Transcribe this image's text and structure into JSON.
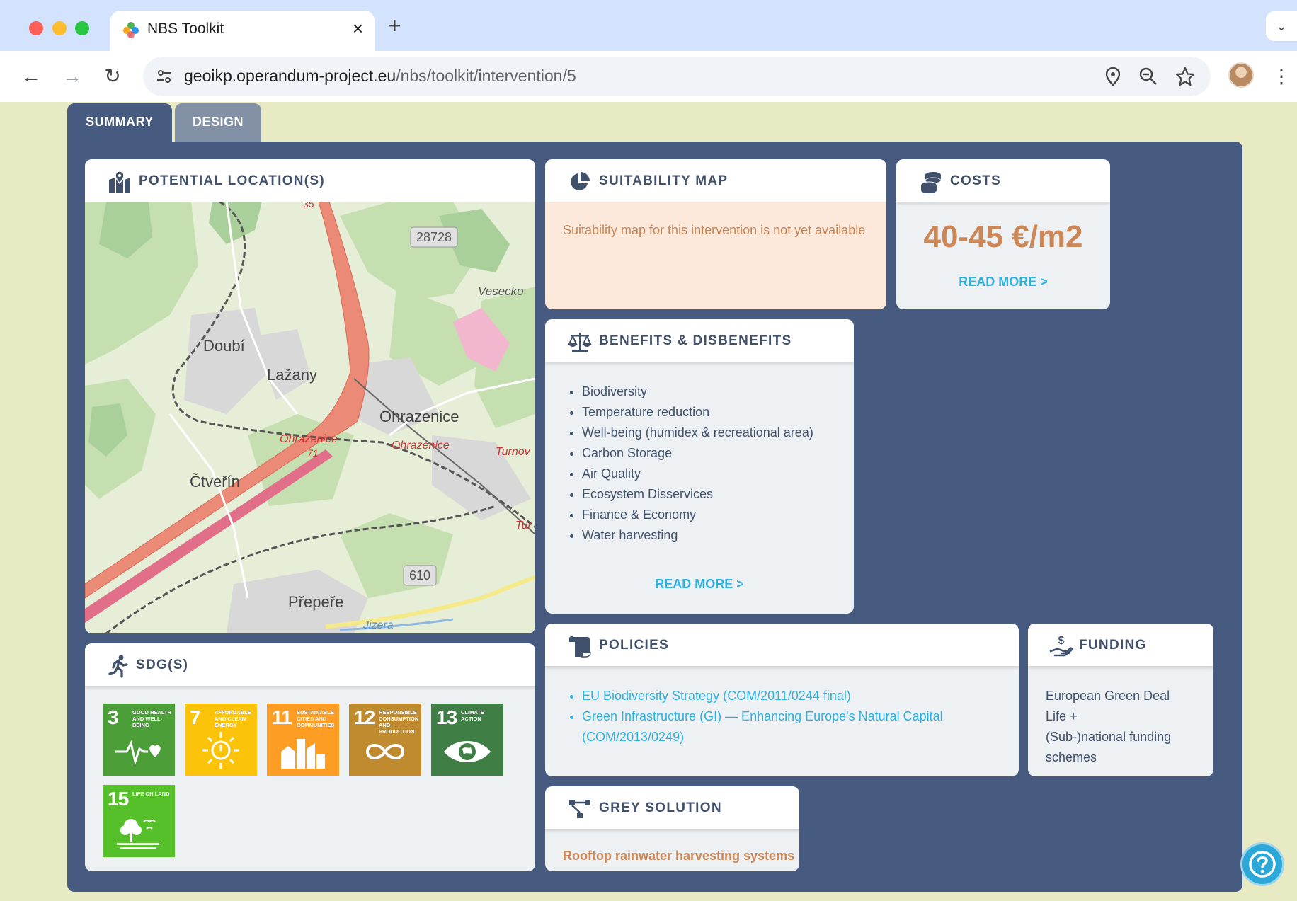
{
  "browser": {
    "tab_title": "NBS Toolkit",
    "url_host": "geoikp.operandum-project.eu",
    "url_path": "/nbs/toolkit/intervention/5"
  },
  "page_tabs": {
    "summary": "SUMMARY",
    "design": "DESIGN"
  },
  "location": {
    "title": "POTENTIAL LOCATION(S)",
    "map_labels": {
      "doubi": "Doubí",
      "lazany": "Lažany",
      "ohrazenice": "Ohrazenice",
      "cverin": "Čtveřín",
      "prepere": "Přepeře",
      "vesecko": "Vesecko",
      "ohrazenice71": "Ohrazenice",
      "km71": "71",
      "ohrazenice_station": "Ohrazenice",
      "turnov": "Turnov",
      "tur": "Tur",
      "jizera": "Jizera",
      "road28728": "28728",
      "road610": "610",
      "road35": "35"
    }
  },
  "suitability": {
    "title": "SUITABILITY MAP",
    "message": "Suitability map for this intervention is not yet available"
  },
  "costs": {
    "title": "COSTS",
    "value": "40-45 €/m2",
    "read_more": "READ MORE >"
  },
  "benefits": {
    "title": "BENEFITS & DISBENEFITS",
    "items": [
      "Biodiversity",
      "Temperature reduction",
      "Well-being (humidex & recreational area)",
      "Carbon Storage",
      "Air Quality",
      "Ecosystem Disservices",
      "Finance & Economy",
      "Water harvesting"
    ],
    "read_more": "READ MORE >"
  },
  "sdgs": {
    "title": "SDG(S)",
    "items": [
      {
        "num": "3",
        "label": "Good health and well-being",
        "color": "#4c9f38"
      },
      {
        "num": "7",
        "label": "Affordable and clean energy",
        "color": "#fcc30b"
      },
      {
        "num": "11",
        "label": "Sustainable cities and communities",
        "color": "#fd9d24"
      },
      {
        "num": "12",
        "label": "Responsible consumption and production",
        "color": "#bf8b2e"
      },
      {
        "num": "13",
        "label": "Climate action",
        "color": "#3f7e44"
      },
      {
        "num": "15",
        "label": "Life on land",
        "color": "#56c02b"
      }
    ]
  },
  "policies": {
    "title": "POLICIES",
    "items": [
      "EU Biodiversity Strategy (COM/2011/0244 final)",
      "Green Infrastructure (GI) — Enhancing Europe's Natural Capital (COM/2013/0249)"
    ]
  },
  "funding": {
    "title": "FUNDING",
    "items": [
      "European Green Deal",
      "Life +",
      "(Sub-)national funding schemes"
    ]
  },
  "grey": {
    "title": "GREY SOLUTION",
    "text": "Rooftop rainwater harvesting systems"
  },
  "colors": {
    "panel": "#475a7f",
    "card": "#edf1f3",
    "accent_orange": "#cd8656",
    "link_blue": "#2fb1e0",
    "heading": "#41506b"
  }
}
